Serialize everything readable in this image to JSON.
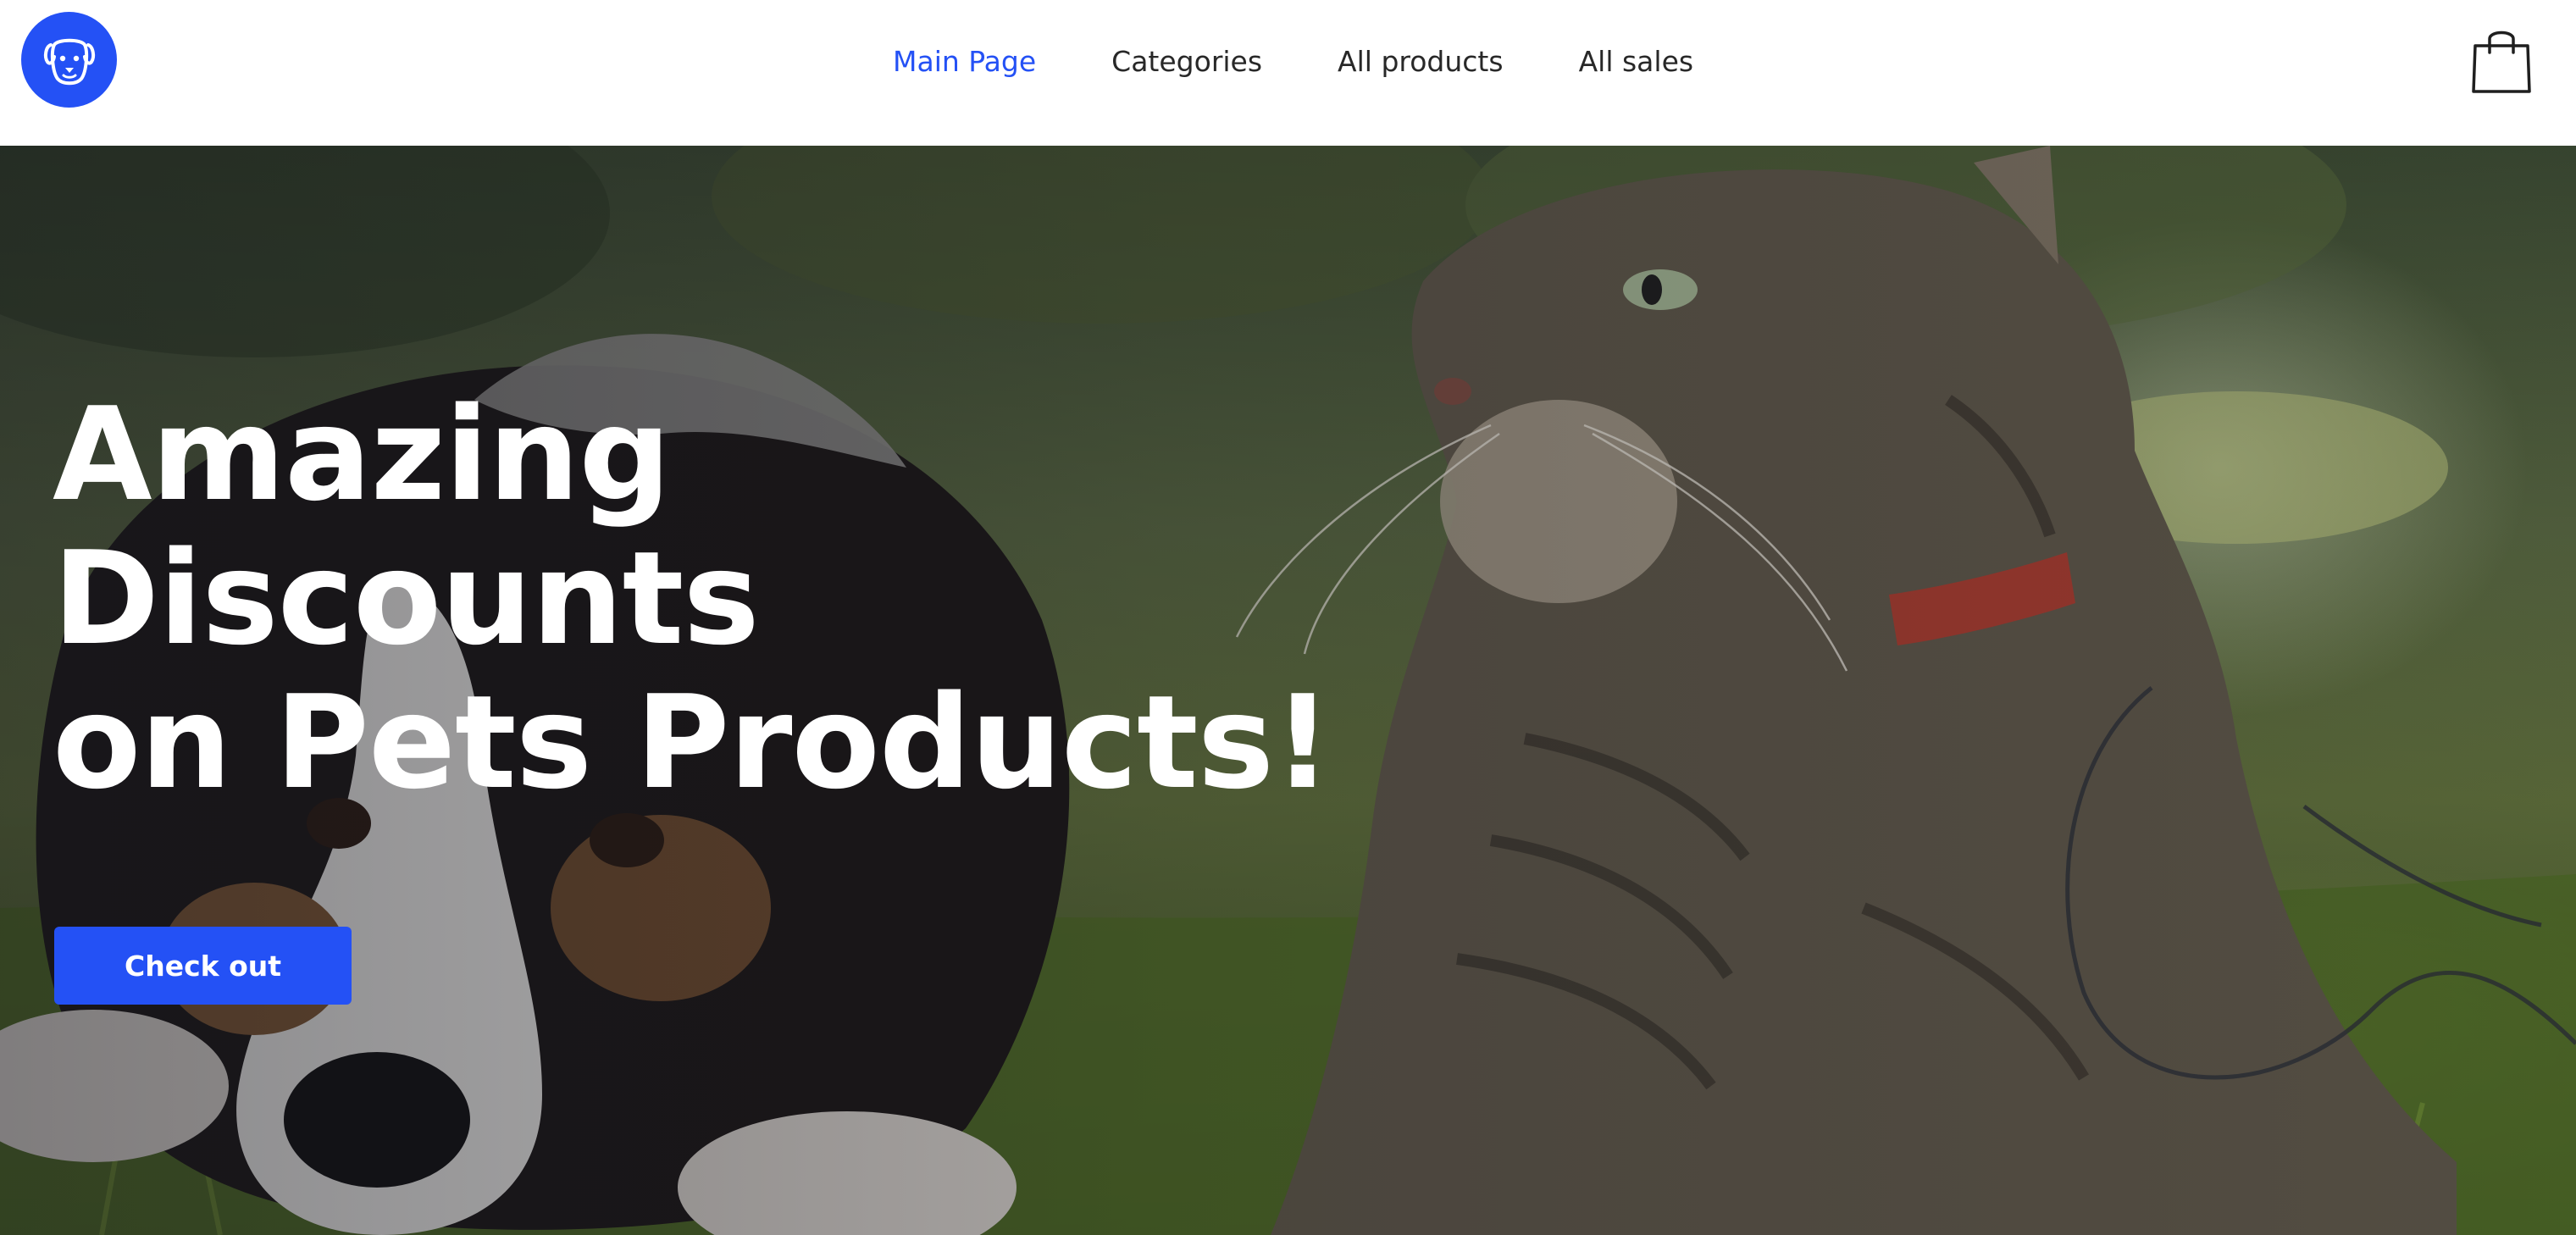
{
  "header": {
    "logo_icon": "dog-face-icon",
    "nav": [
      {
        "label": "Main Page",
        "active": true
      },
      {
        "label": "Categories",
        "active": false
      },
      {
        "label": "All products",
        "active": false
      },
      {
        "label": "All sales",
        "active": false
      }
    ],
    "cart_icon": "shopping-bag-icon"
  },
  "hero": {
    "title_lines": [
      "Amazing",
      "Discounts",
      "on Pets Products!"
    ],
    "cta_label": "Check out",
    "image": "puppy-and-cat-on-grass"
  },
  "colors": {
    "accent": "#2451f5",
    "nav_text": "#282828",
    "hero_text": "#ffffff",
    "header_bg": "#ffffff"
  }
}
